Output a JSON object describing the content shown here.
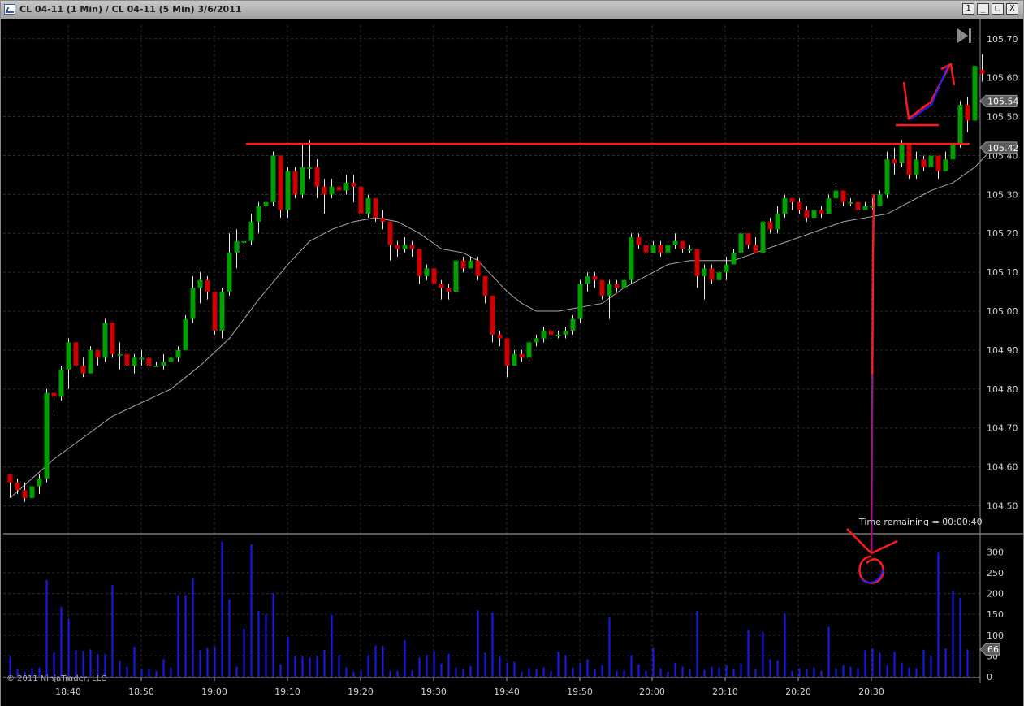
{
  "window": {
    "title": "CL 04-11 (1 Min) / CL 04-11 (5 Min)  3/6/2011",
    "buttons": [
      "1",
      "_",
      "□",
      "X"
    ]
  },
  "status": {
    "time_remaining": "Time remaining = 00:00:40",
    "copyright": "© 2011 NinjaTrader, LLC"
  },
  "icons": {
    "play_to_end": "skip-to-end-icon",
    "app": "chart-icon"
  },
  "colors": {
    "up": "#00a000",
    "down": "#d00000",
    "volume": "#1a1aff",
    "sma": "#a8a8a8",
    "annotation": "#ff1a1a",
    "annotation_blue": "#2020ff",
    "grid": "#2e2e2e"
  },
  "chart_data": {
    "type": "candlestick",
    "title": "",
    "price_axis": {
      "ylim": [
        104.43,
        105.735
      ],
      "ticks": [
        "104.50",
        "104.60",
        "104.70",
        "104.80",
        "104.90",
        "105.00",
        "105.10",
        "105.20",
        "105.30",
        "105.40",
        "105.50",
        "105.60",
        "105.70"
      ],
      "markers": [
        {
          "label": "105.54",
          "value": 105.54
        },
        {
          "label": "105.42",
          "value": 105.42
        }
      ]
    },
    "time_axis": {
      "ticks": [
        "18:40",
        "18:50",
        "19:00",
        "19:10",
        "19:20",
        "19:30",
        "19:40",
        "19:50",
        "20:00",
        "20:10",
        "20:20",
        "20:30"
      ]
    },
    "volume_axis": {
      "ylim": [
        0,
        330
      ],
      "ticks": [
        "0",
        "50",
        "100",
        "150",
        "200",
        "250",
        "300"
      ],
      "marker": {
        "label": "66",
        "value": 66
      }
    },
    "horizontal_line": 105.43,
    "candles": [
      [
        104.58,
        104.56,
        104.58,
        104.52
      ],
      [
        104.56,
        104.54,
        104.57,
        104.53
      ],
      [
        104.54,
        104.52,
        104.56,
        104.51
      ],
      [
        104.52,
        104.55,
        104.56,
        104.52
      ],
      [
        104.55,
        104.57,
        104.58,
        104.53
      ],
      [
        104.57,
        104.79,
        104.8,
        104.56
      ],
      [
        104.79,
        104.78,
        104.79,
        104.74
      ],
      [
        104.78,
        104.85,
        104.86,
        104.77
      ],
      [
        104.85,
        104.92,
        104.93,
        104.8
      ],
      [
        104.92,
        104.86,
        104.92,
        104.83
      ],
      [
        104.86,
        104.84,
        104.88,
        104.83
      ],
      [
        104.84,
        104.9,
        104.91,
        104.84
      ],
      [
        104.9,
        104.88,
        104.9,
        104.86
      ],
      [
        104.88,
        104.97,
        104.98,
        104.87
      ],
      [
        104.97,
        104.89,
        104.97,
        104.88
      ],
      [
        104.89,
        104.89,
        104.92,
        104.85
      ],
      [
        104.89,
        104.86,
        104.9,
        104.85
      ],
      [
        104.86,
        104.88,
        104.89,
        104.84
      ],
      [
        104.88,
        104.88,
        104.9,
        104.86
      ],
      [
        104.88,
        104.86,
        104.89,
        104.85
      ],
      [
        104.86,
        104.86,
        104.87,
        104.86
      ],
      [
        104.86,
        104.87,
        104.89,
        104.85
      ],
      [
        104.87,
        104.88,
        104.89,
        104.87
      ],
      [
        104.88,
        104.9,
        104.91,
        104.87
      ],
      [
        104.9,
        104.98,
        104.99,
        104.91
      ],
      [
        104.98,
        105.06,
        105.09,
        104.97
      ],
      [
        105.06,
        105.08,
        105.1,
        105.02
      ],
      [
        105.08,
        105.05,
        105.09,
        105.03
      ],
      [
        105.05,
        104.95,
        105.05,
        104.94
      ],
      [
        104.95,
        105.05,
        105.06,
        104.93
      ],
      [
        105.05,
        105.15,
        105.2,
        105.04
      ],
      [
        105.15,
        105.18,
        105.21,
        105.11
      ],
      [
        105.18,
        105.18,
        105.2,
        105.14
      ],
      [
        105.18,
        105.23,
        105.25,
        105.17
      ],
      [
        105.23,
        105.27,
        105.28,
        105.2
      ],
      [
        105.27,
        105.28,
        105.3,
        105.24
      ],
      [
        105.28,
        105.4,
        105.41,
        105.27
      ],
      [
        105.4,
        105.26,
        105.4,
        105.24
      ],
      [
        105.26,
        105.36,
        105.37,
        105.24
      ],
      [
        105.36,
        105.3,
        105.37,
        105.29
      ],
      [
        105.3,
        105.37,
        105.43,
        105.29
      ],
      [
        105.37,
        105.37,
        105.44,
        105.34
      ],
      [
        105.37,
        105.32,
        105.39,
        105.29
      ],
      [
        105.32,
        105.3,
        105.34,
        105.25
      ],
      [
        105.3,
        105.32,
        105.34,
        105.29
      ],
      [
        105.32,
        105.31,
        105.35,
        105.29
      ],
      [
        105.31,
        105.33,
        105.35,
        105.3
      ],
      [
        105.33,
        105.32,
        105.35,
        105.28
      ],
      [
        105.32,
        105.25,
        105.32,
        105.21
      ],
      [
        105.25,
        105.29,
        105.3,
        105.24
      ],
      [
        105.29,
        105.24,
        105.29,
        105.23
      ],
      [
        105.24,
        105.23,
        105.26,
        105.21
      ],
      [
        105.23,
        105.17,
        105.23,
        105.13
      ],
      [
        105.17,
        105.16,
        105.18,
        105.14
      ],
      [
        105.16,
        105.17,
        105.19,
        105.15
      ],
      [
        105.17,
        105.16,
        105.18,
        105.14
      ],
      [
        105.16,
        105.09,
        105.16,
        105.07
      ],
      [
        105.09,
        105.11,
        105.12,
        105.08
      ],
      [
        105.11,
        105.07,
        105.11,
        105.06
      ],
      [
        105.07,
        105.06,
        105.08,
        105.03
      ],
      [
        105.06,
        105.05,
        105.07,
        105.03
      ],
      [
        105.05,
        105.13,
        105.14,
        105.05
      ],
      [
        105.13,
        105.11,
        105.14,
        105.1
      ],
      [
        105.11,
        105.13,
        105.14,
        105.11
      ],
      [
        105.13,
        105.09,
        105.14,
        105.08
      ],
      [
        105.09,
        105.04,
        105.09,
        105.02
      ],
      [
        105.04,
        104.94,
        105.04,
        104.92
      ],
      [
        104.94,
        104.93,
        104.95,
        104.91
      ],
      [
        104.93,
        104.86,
        104.93,
        104.83
      ],
      [
        104.86,
        104.89,
        104.9,
        104.86
      ],
      [
        104.89,
        104.88,
        104.9,
        104.87
      ],
      [
        104.88,
        104.92,
        104.93,
        104.87
      ],
      [
        104.92,
        104.93,
        104.94,
        104.91
      ],
      [
        104.93,
        104.95,
        104.96,
        104.92
      ],
      [
        104.95,
        104.94,
        104.96,
        104.93
      ],
      [
        104.94,
        104.94,
        104.95,
        104.93
      ],
      [
        104.94,
        104.95,
        104.96,
        104.93
      ],
      [
        104.95,
        104.98,
        104.99,
        104.94
      ],
      [
        104.98,
        105.07,
        105.08,
        104.97
      ],
      [
        105.07,
        105.09,
        105.1,
        105.05
      ],
      [
        105.09,
        105.08,
        105.1,
        105.06
      ],
      [
        105.08,
        105.04,
        105.08,
        105.03
      ],
      [
        105.04,
        105.07,
        105.08,
        104.98
      ],
      [
        105.07,
        105.06,
        105.08,
        105.05
      ],
      [
        105.06,
        105.08,
        105.1,
        105.05
      ],
      [
        105.08,
        105.19,
        105.2,
        105.07
      ],
      [
        105.19,
        105.17,
        105.2,
        105.16
      ],
      [
        105.17,
        105.15,
        105.18,
        105.14
      ],
      [
        105.15,
        105.17,
        105.18,
        105.15
      ],
      [
        105.17,
        105.15,
        105.18,
        105.14
      ],
      [
        105.15,
        105.17,
        105.18,
        105.14
      ],
      [
        105.17,
        105.18,
        105.2,
        105.16
      ],
      [
        105.18,
        105.16,
        105.18,
        105.15
      ],
      [
        105.16,
        105.16,
        105.17,
        105.15
      ],
      [
        105.16,
        105.09,
        105.16,
        105.06
      ],
      [
        105.09,
        105.11,
        105.12,
        105.03
      ],
      [
        105.11,
        105.08,
        105.12,
        105.07
      ],
      [
        105.08,
        105.1,
        105.11,
        105.08
      ],
      [
        105.1,
        105.12,
        105.14,
        105.08
      ],
      [
        105.12,
        105.15,
        105.16,
        105.12
      ],
      [
        105.15,
        105.2,
        105.21,
        105.14
      ],
      [
        105.2,
        105.17,
        105.2,
        105.16
      ],
      [
        105.17,
        105.15,
        105.19,
        105.15
      ],
      [
        105.15,
        105.23,
        105.24,
        105.15
      ],
      [
        105.23,
        105.21,
        105.24,
        105.2
      ],
      [
        105.21,
        105.25,
        105.27,
        105.2
      ],
      [
        105.25,
        105.29,
        105.3,
        105.24
      ],
      [
        105.29,
        105.28,
        105.29,
        105.26
      ],
      [
        105.28,
        105.26,
        105.29,
        105.25
      ],
      [
        105.26,
        105.24,
        105.27,
        105.23
      ],
      [
        105.24,
        105.26,
        105.27,
        105.24
      ],
      [
        105.26,
        105.25,
        105.27,
        105.24
      ],
      [
        105.25,
        105.29,
        105.3,
        105.25
      ],
      [
        105.29,
        105.31,
        105.33,
        105.28
      ],
      [
        105.31,
        105.28,
        105.31,
        105.27
      ],
      [
        105.28,
        105.28,
        105.29,
        105.27
      ],
      [
        105.28,
        105.26,
        105.28,
        105.25
      ],
      [
        105.26,
        105.27,
        105.28,
        105.26
      ],
      [
        105.27,
        105.27,
        105.29,
        105.26
      ],
      [
        105.27,
        105.3,
        105.31,
        105.27
      ],
      [
        105.3,
        105.39,
        105.41,
        105.29
      ],
      [
        105.39,
        105.38,
        105.42,
        105.35
      ],
      [
        105.38,
        105.43,
        105.44,
        105.37
      ],
      [
        105.43,
        105.35,
        105.43,
        105.34
      ],
      [
        105.35,
        105.39,
        105.41,
        105.34
      ],
      [
        105.39,
        105.37,
        105.4,
        105.36
      ],
      [
        105.37,
        105.4,
        105.41,
        105.36
      ],
      [
        105.4,
        105.36,
        105.4,
        105.34
      ],
      [
        105.36,
        105.39,
        105.41,
        105.36
      ],
      [
        105.39,
        105.43,
        105.44,
        105.38
      ],
      [
        105.43,
        105.53,
        105.54,
        105.42
      ],
      [
        105.53,
        105.49,
        105.55,
        105.46
      ],
      [
        105.49,
        105.63,
        105.63,
        105.49
      ],
      [
        105.62,
        105.61,
        105.66,
        105.59
      ]
    ],
    "sma": [
      [
        0,
        104.52
      ],
      [
        6,
        104.62
      ],
      [
        14,
        104.73
      ],
      [
        22,
        104.8
      ],
      [
        26,
        104.86
      ],
      [
        30,
        104.93
      ],
      [
        34,
        105.03
      ],
      [
        38,
        105.12
      ],
      [
        41,
        105.18
      ],
      [
        44,
        105.21
      ],
      [
        47,
        105.23
      ],
      [
        50,
        105.24
      ],
      [
        53,
        105.23
      ],
      [
        56,
        105.2
      ],
      [
        59,
        105.16
      ],
      [
        62,
        105.15
      ],
      [
        64,
        105.13
      ],
      [
        66,
        105.09
      ],
      [
        68,
        105.05
      ],
      [
        70,
        105.02
      ],
      [
        72,
        105.0
      ],
      [
        75,
        105.0
      ],
      [
        78,
        105.01
      ],
      [
        81,
        105.02
      ],
      [
        84,
        105.06
      ],
      [
        87,
        105.09
      ],
      [
        90,
        105.12
      ],
      [
        93,
        105.13
      ],
      [
        96,
        105.13
      ],
      [
        99,
        105.13
      ],
      [
        102,
        105.15
      ],
      [
        105,
        105.17
      ],
      [
        108,
        105.19
      ],
      [
        111,
        105.21
      ],
      [
        114,
        105.23
      ],
      [
        117,
        105.24
      ],
      [
        120,
        105.25
      ],
      [
        123,
        105.28
      ],
      [
        126,
        105.31
      ],
      [
        129,
        105.33
      ],
      [
        132,
        105.37
      ],
      [
        134,
        105.41
      ]
    ],
    "volume": [
      48,
      18,
      12,
      20,
      22,
      232,
      58,
      168,
      140,
      64,
      62,
      66,
      54,
      55,
      220,
      38,
      24,
      72,
      18,
      18,
      14,
      42,
      22,
      196,
      196,
      236,
      64,
      70,
      72,
      325,
      186,
      24,
      115,
      318,
      158,
      150,
      200,
      30,
      95,
      50,
      48,
      46,
      50,
      65,
      148,
      52,
      22,
      12,
      15,
      52,
      75,
      74,
      14,
      14,
      88,
      15,
      46,
      52,
      62,
      32,
      55,
      22,
      18,
      26,
      160,
      58,
      155,
      48,
      34,
      36,
      12,
      20,
      18,
      22,
      14,
      60,
      52,
      22,
      34,
      42,
      18,
      28,
      142,
      14,
      16,
      52,
      30,
      14,
      70,
      20,
      12,
      34,
      24,
      18,
      158,
      16,
      24,
      22,
      28,
      18,
      32,
      112,
      18,
      108,
      42,
      40,
      152,
      14,
      20,
      18,
      22,
      14,
      120,
      20,
      28,
      24,
      20,
      64,
      68,
      58,
      28,
      60,
      34,
      22,
      20,
      65,
      50,
      298,
      68,
      205,
      190,
      66
    ],
    "annotations": [
      "red horizontal line at 105.43",
      "red vertical line from volume spike to price",
      "red/blue hand-drawn check mark near 105.50-105.60",
      "red/blue hand-drawn circle around volume spike"
    ]
  }
}
